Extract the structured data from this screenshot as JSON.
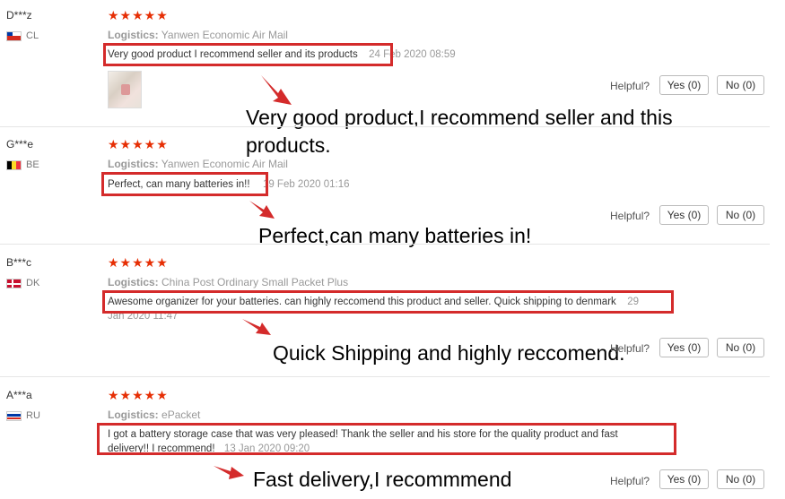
{
  "reviews": [
    {
      "user": "D***z",
      "country": "CL",
      "stars": "★★★★★",
      "logistics_label": "Logistics:",
      "logistics": "Yanwen Economic Air Mail",
      "comment": "Very good product I recommend seller and its products",
      "date": "24 Feb 2020 08:59",
      "annotation": "Very good product,I recommend seller and this products.",
      "helpful_label": "Helpful?",
      "yes_label": "Yes (0)",
      "no_label": "No (0)"
    },
    {
      "user": "G***e",
      "country": "BE",
      "stars": "★★★★★",
      "logistics_label": "Logistics:",
      "logistics": "Yanwen Economic Air Mail",
      "comment": "Perfect, can many batteries in!!",
      "date": "19 Feb 2020 01:16",
      "annotation": "Perfect,can many batteries in!",
      "helpful_label": "Helpful?",
      "yes_label": "Yes (0)",
      "no_label": "No (0)"
    },
    {
      "user": "B***c",
      "country": "DK",
      "stars": "★★★★★",
      "logistics_label": "Logistics:",
      "logistics": "China Post Ordinary Small Packet Plus",
      "comment": "Awesome organizer for your batteries. can highly reccomend this product and seller. Quick shipping to denmark",
      "date_part1": "29",
      "date_part2": "Jan 2020 11:47",
      "annotation": "Quick Shipping and highly reccomend.",
      "helpful_label": "Helpful?",
      "yes_label": "Yes (0)",
      "no_label": "No (0)"
    },
    {
      "user": "A***a",
      "country": "RU",
      "stars": "★★★★★",
      "logistics_label": "Logistics:",
      "logistics": "ePacket",
      "comment_line1": "I got a battery storage case that was very pleased! Thank the seller and his store for the quality product and fast",
      "comment_line2": "delivery!! I recommend!",
      "date": "13 Jan 2020 09:20",
      "annotation": "Fast delivery,I recommmend",
      "helpful_label": "Helpful?",
      "yes_label": "Yes (0)",
      "no_label": "No (0)"
    }
  ],
  "colors": {
    "stars": "#e62e04",
    "highlight_box": "#d42b2b"
  }
}
